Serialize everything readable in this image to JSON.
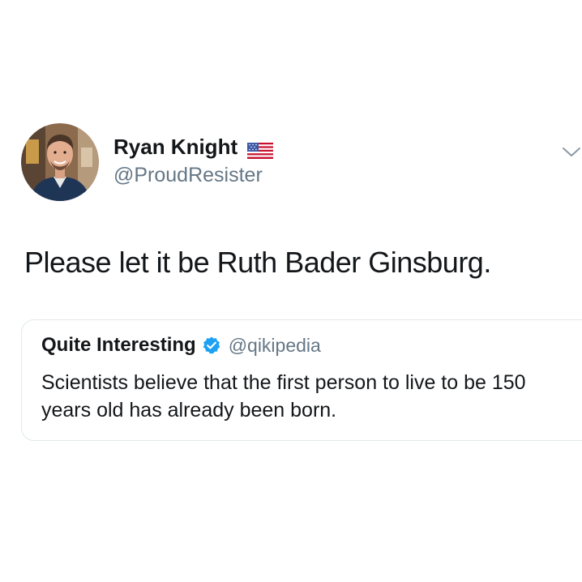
{
  "tweet": {
    "author": {
      "name": "Ryan Knight",
      "handle": "@ProudResister",
      "flag_icon": "us-flag-icon",
      "avatar_icon": "profile-photo"
    },
    "text": "Please let it be Ruth Bader Ginsburg.",
    "more_icon": "chevron-down-icon"
  },
  "quoted_tweet": {
    "author": {
      "name": "Quite Interesting",
      "handle": "@qikipedia",
      "verified_icon": "verified-badge-icon"
    },
    "text": "Scientists believe that the first person to live to be 150 years old has already been born."
  },
  "colors": {
    "text_primary": "#14171a",
    "text_secondary": "#657786",
    "verified_blue": "#1da1f2",
    "card_border": "#e1e8ed"
  }
}
